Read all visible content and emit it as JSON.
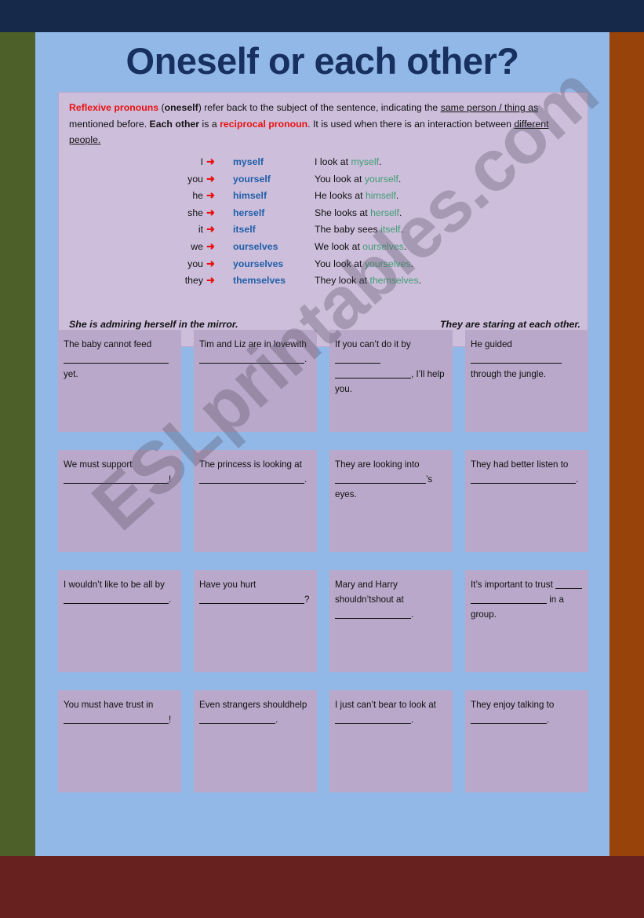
{
  "colors": {
    "frame_top": "#16294a",
    "frame_left": "#4e6029",
    "frame_right": "#97430a",
    "frame_bottom": "#67221f",
    "page_bg": "#92b8e8",
    "panel_bg": "#cdbedb",
    "cell_bg": "#b9a8c9",
    "title": "#17305f",
    "accent_red": "#e8110f",
    "accent_blue": "#1f5fa8",
    "accent_green": "#3e9e72"
  },
  "title": "Oneself or each other?",
  "explanation": {
    "part1_bold_red": "Reflexive pronouns",
    "part2": " (",
    "part3_bold": "oneself",
    "part4": ")  refer back to the subject of the sentence, indicating the ",
    "part5_underline": "same person / thing as",
    "part6": " mentioned before. ",
    "part7_bold": "Each other",
    "part8": " is a ",
    "part9_bold_red": "reciprocal pronoun",
    "part10": ". It is used when there is an interaction between ",
    "part11_underline": "different people."
  },
  "pronoun_table": {
    "arrow_glyph": "➜",
    "rows": [
      {
        "subject": "I",
        "reflexive": "myself",
        "example_pre": "I look at ",
        "example_word": "myself",
        "example_post": "."
      },
      {
        "subject": "you",
        "reflexive": "yourself",
        "example_pre": "You look at ",
        "example_word": "yourself",
        "example_post": "."
      },
      {
        "subject": "he",
        "reflexive": "himself",
        "example_pre": "He looks at ",
        "example_word": "himself",
        "example_post": "."
      },
      {
        "subject": "she",
        "reflexive": "herself",
        "example_pre": "She looks at ",
        "example_word": "herself",
        "example_post": "."
      },
      {
        "subject": "it",
        "reflexive": "itself",
        "example_pre": "The baby sees ",
        "example_word": "itself",
        "example_post": "."
      },
      {
        "subject": "we",
        "reflexive": "ourselves",
        "example_pre": "We look at ",
        "example_word": "ourselves",
        "example_post": "."
      },
      {
        "subject": "you",
        "reflexive": "yourselves",
        "example_pre": "You look at ",
        "example_word": "yourselves",
        "example_post": "."
      },
      {
        "subject": "they",
        "reflexive": "themselves",
        "example_pre": "They look at ",
        "example_word": "themselves",
        "example_post": "."
      }
    ]
  },
  "captions": {
    "left": "She is admiring herself in the mirror.",
    "right": "They are staring at each other."
  },
  "exercises": {
    "rows": [
      [
        {
          "a": "The baby cannot feed",
          "b": "",
          "c": " yet.",
          "blank1": "b-xxl",
          "blank2": ""
        },
        {
          "a": "Tim and Liz are in love",
          "b": "with ",
          "c": ".",
          "blank1": "",
          "blank2": "b-xxl"
        },
        {
          "a": "If you can’t do it by ",
          "b": "",
          "c": ", I’ll help you.",
          "blank1": "b-sm",
          "blank2": "b-lg"
        },
        {
          "a": "He guided ",
          "b": "through the jungle.",
          "c": "",
          "blank1": "b-xl",
          "blank2": ""
        }
      ],
      [
        {
          "a": "We must support",
          "b": "",
          "c": "!",
          "blank1": "b-xxl",
          "blank2": ""
        },
        {
          "a": "The princess is looking at",
          "b": "",
          "c": ".",
          "blank1": "b-xxl",
          "blank2": ""
        },
        {
          "a": "They are looking into",
          "b": "",
          "c": "’s eyes.",
          "blank1": "b-xl",
          "blank2": ""
        },
        {
          "a": "They had better listen to",
          "b": "",
          "c": ".",
          "blank1": "b-xxl",
          "blank2": ""
        }
      ],
      [
        {
          "a": "I wouldn’t like to be all by",
          "b": "",
          "c": ".",
          "blank1": "b-xxl",
          "blank2": ""
        },
        {
          "a": "Have you hurt",
          "b": "",
          "c": "?",
          "blank1": "b-xxl",
          "blank2": ""
        },
        {
          "a": "Mary and Harry shouldn’t",
          "b": "shout at ",
          "c": ".",
          "blank1": "",
          "blank2": "b-lg"
        },
        {
          "a": "It’s important to trust ",
          "b": "",
          "c": " in a group.",
          "blank1": "b-xs",
          "blank2": "b-lg"
        }
      ],
      [
        {
          "a": "You must have trust in",
          "b": "",
          "c": "!",
          "blank1": "b-xxl",
          "blank2": ""
        },
        {
          "a": "Even strangers should",
          "b": "help ",
          "c": ".",
          "blank1": "",
          "blank2": "b-lg"
        },
        {
          "a": "I just can’t bear to look at",
          "b": "",
          "c": ".",
          "blank1": "b-lg",
          "blank2": ""
        },
        {
          "a": "They enjoy talking to",
          "b": "",
          "c": ".",
          "blank1": "b-lg",
          "blank2": ""
        }
      ]
    ]
  },
  "watermark": "ESLprintables.com"
}
